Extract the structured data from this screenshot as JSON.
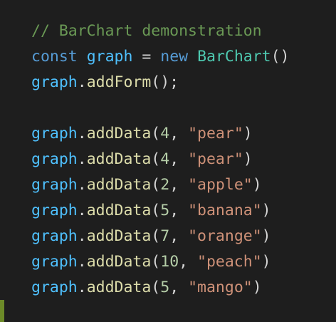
{
  "editor": {
    "colors": {
      "background": "#1e1e1e",
      "comment": "#6a9955",
      "keyword": "#569cd6",
      "variable": "#4fc1ff",
      "function": "#dcdcaa",
      "class": "#4ec9b0",
      "number": "#b5cea8",
      "string": "#ce9178",
      "punctuation": "#d4d4d4",
      "gutter_marker": "#6c8a28"
    },
    "lines": [
      [
        {
          "t": "comment",
          "v": "// BarChart demonstration"
        }
      ],
      [
        {
          "t": "keyword",
          "v": "const"
        },
        {
          "t": "punc",
          "v": " "
        },
        {
          "t": "var",
          "v": "graph"
        },
        {
          "t": "punc",
          "v": " = "
        },
        {
          "t": "keyword",
          "v": "new"
        },
        {
          "t": "punc",
          "v": " "
        },
        {
          "t": "class",
          "v": "BarChart"
        },
        {
          "t": "punc",
          "v": "()"
        }
      ],
      [
        {
          "t": "var",
          "v": "graph"
        },
        {
          "t": "punc",
          "v": "."
        },
        {
          "t": "fn",
          "v": "addForm"
        },
        {
          "t": "punc",
          "v": "();"
        }
      ],
      [],
      [
        {
          "t": "var",
          "v": "graph"
        },
        {
          "t": "punc",
          "v": "."
        },
        {
          "t": "fn",
          "v": "addData"
        },
        {
          "t": "punc",
          "v": "("
        },
        {
          "t": "num",
          "v": "4"
        },
        {
          "t": "punc",
          "v": ", "
        },
        {
          "t": "str",
          "v": "\"pear\""
        },
        {
          "t": "punc",
          "v": ")"
        }
      ],
      [
        {
          "t": "var",
          "v": "graph"
        },
        {
          "t": "punc",
          "v": "."
        },
        {
          "t": "fn",
          "v": "addData"
        },
        {
          "t": "punc",
          "v": "("
        },
        {
          "t": "num",
          "v": "4"
        },
        {
          "t": "punc",
          "v": ", "
        },
        {
          "t": "str",
          "v": "\"pear\""
        },
        {
          "t": "punc",
          "v": ")"
        }
      ],
      [
        {
          "t": "var",
          "v": "graph"
        },
        {
          "t": "punc",
          "v": "."
        },
        {
          "t": "fn",
          "v": "addData"
        },
        {
          "t": "punc",
          "v": "("
        },
        {
          "t": "num",
          "v": "2"
        },
        {
          "t": "punc",
          "v": ", "
        },
        {
          "t": "str",
          "v": "\"apple\""
        },
        {
          "t": "punc",
          "v": ")"
        }
      ],
      [
        {
          "t": "var",
          "v": "graph"
        },
        {
          "t": "punc",
          "v": "."
        },
        {
          "t": "fn",
          "v": "addData"
        },
        {
          "t": "punc",
          "v": "("
        },
        {
          "t": "num",
          "v": "5"
        },
        {
          "t": "punc",
          "v": ", "
        },
        {
          "t": "str",
          "v": "\"banana\""
        },
        {
          "t": "punc",
          "v": ")"
        }
      ],
      [
        {
          "t": "var",
          "v": "graph"
        },
        {
          "t": "punc",
          "v": "."
        },
        {
          "t": "fn",
          "v": "addData"
        },
        {
          "t": "punc",
          "v": "("
        },
        {
          "t": "num",
          "v": "7"
        },
        {
          "t": "punc",
          "v": ", "
        },
        {
          "t": "str",
          "v": "\"orange\""
        },
        {
          "t": "punc",
          "v": ")"
        }
      ],
      [
        {
          "t": "var",
          "v": "graph"
        },
        {
          "t": "punc",
          "v": "."
        },
        {
          "t": "fn",
          "v": "addData"
        },
        {
          "t": "punc",
          "v": "("
        },
        {
          "t": "num",
          "v": "10"
        },
        {
          "t": "punc",
          "v": ", "
        },
        {
          "t": "str",
          "v": "\"peach\""
        },
        {
          "t": "punc",
          "v": ")"
        }
      ],
      [
        {
          "t": "var",
          "v": "graph"
        },
        {
          "t": "punc",
          "v": "."
        },
        {
          "t": "fn",
          "v": "addData"
        },
        {
          "t": "punc",
          "v": "("
        },
        {
          "t": "num",
          "v": "5"
        },
        {
          "t": "punc",
          "v": ", "
        },
        {
          "t": "str",
          "v": "\"mango\""
        },
        {
          "t": "punc",
          "v": ")"
        }
      ]
    ]
  }
}
